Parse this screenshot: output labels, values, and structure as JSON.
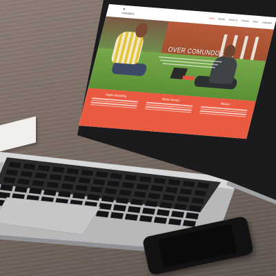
{
  "scene": {
    "colors": {
      "desk": "#7d6f66",
      "laptop_silver": "#c9cbcd",
      "keyboard": "#1c1c1e",
      "accent": "#ea5a40"
    }
  },
  "website": {
    "logo_text": "COMUNDOS",
    "nav": [
      "Home",
      "Nieuws",
      "About Us",
      "Partners",
      "News",
      "Languages"
    ],
    "hero_title": "OVER COMUNDOS",
    "cards": [
      {
        "title": "Digital storytelling"
      },
      {
        "title": "Media Literacy"
      },
      {
        "title": "Mission"
      }
    ]
  }
}
